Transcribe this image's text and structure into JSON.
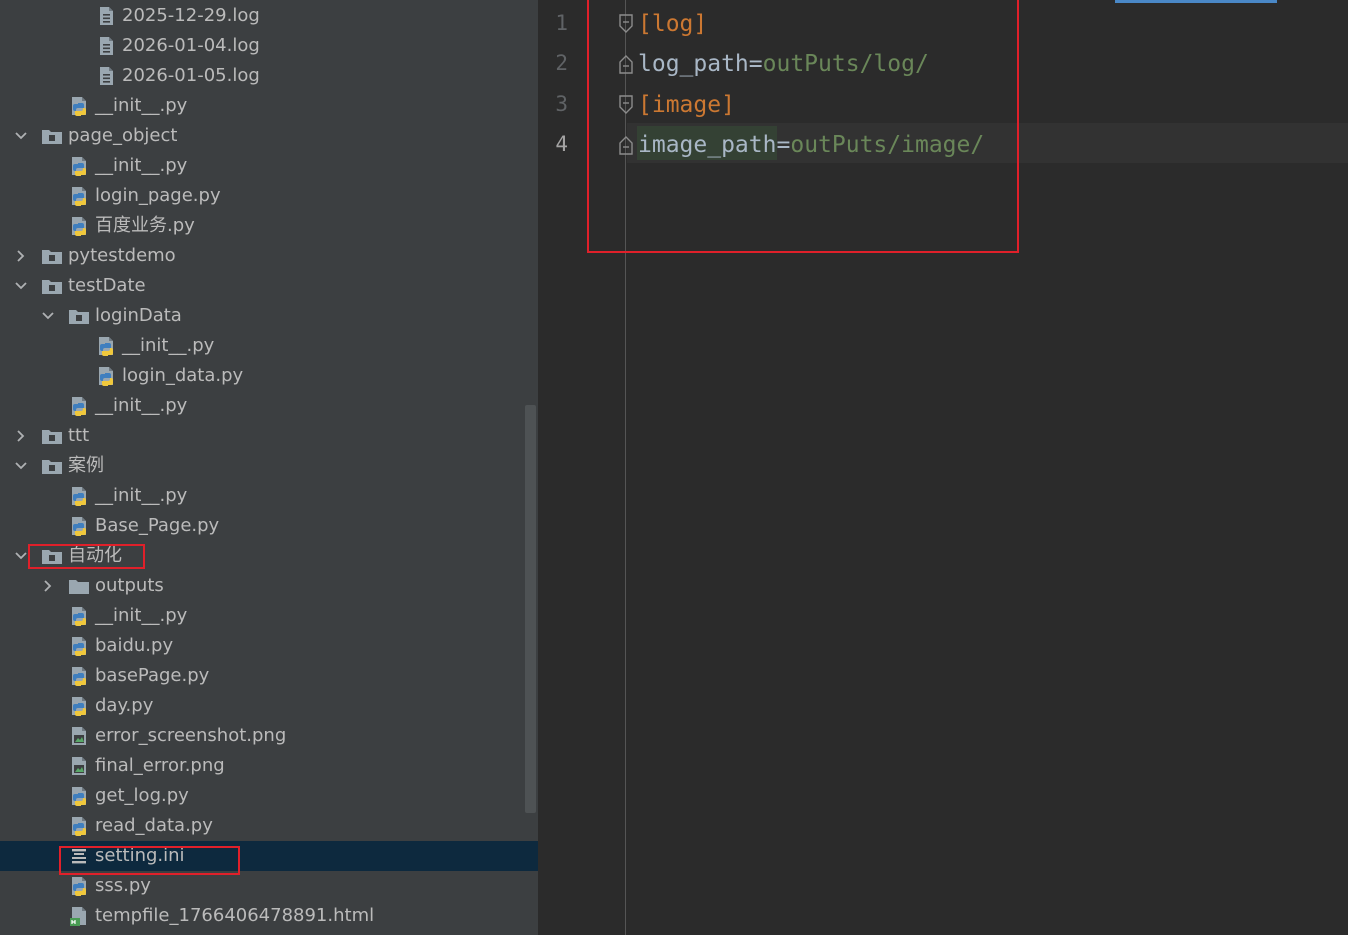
{
  "project_tree": {
    "items": [
      {
        "label": "2025-12-29.log",
        "icon": "log-file-icon",
        "expand": "none",
        "depth": 3
      },
      {
        "label": "2026-01-04.log",
        "icon": "log-file-icon",
        "expand": "none",
        "depth": 3
      },
      {
        "label": "2026-01-05.log",
        "icon": "log-file-icon",
        "expand": "none",
        "depth": 3
      },
      {
        "label": "__init__.py",
        "icon": "python-file-icon",
        "expand": "none",
        "depth": 2
      },
      {
        "label": "page_object",
        "icon": "package-folder-icon",
        "expand": "expanded",
        "depth": 1
      },
      {
        "label": "__init__.py",
        "icon": "python-file-icon",
        "expand": "none",
        "depth": 2
      },
      {
        "label": "login_page.py",
        "icon": "python-file-icon",
        "expand": "none",
        "depth": 2
      },
      {
        "label": "百度业务.py",
        "icon": "python-file-icon",
        "expand": "none",
        "depth": 2
      },
      {
        "label": "pytestdemo",
        "icon": "package-folder-icon",
        "expand": "collapsed",
        "depth": 1
      },
      {
        "label": "testDate",
        "icon": "package-folder-icon",
        "expand": "expanded",
        "depth": 1
      },
      {
        "label": "loginData",
        "icon": "package-folder-icon",
        "expand": "expanded",
        "depth": 2
      },
      {
        "label": "__init__.py",
        "icon": "python-file-icon",
        "expand": "none",
        "depth": 3
      },
      {
        "label": "login_data.py",
        "icon": "python-file-icon",
        "expand": "none",
        "depth": 3
      },
      {
        "label": "__init__.py",
        "icon": "python-file-icon",
        "expand": "none",
        "depth": 2
      },
      {
        "label": "ttt",
        "icon": "package-folder-icon",
        "expand": "collapsed",
        "depth": 1
      },
      {
        "label": "案例",
        "icon": "package-folder-icon",
        "expand": "expanded",
        "depth": 1
      },
      {
        "label": "__init__.py",
        "icon": "python-file-icon",
        "expand": "none",
        "depth": 2
      },
      {
        "label": "Base_Page.py",
        "icon": "python-file-icon",
        "expand": "none",
        "depth": 2
      },
      {
        "label": "自动化",
        "icon": "package-folder-icon",
        "expand": "expanded",
        "depth": 1
      },
      {
        "label": "outputs",
        "icon": "folder-icon",
        "expand": "collapsed",
        "depth": 2
      },
      {
        "label": "__init__.py",
        "icon": "python-file-icon",
        "expand": "none",
        "depth": 2
      },
      {
        "label": "baidu.py",
        "icon": "python-file-icon",
        "expand": "none",
        "depth": 2
      },
      {
        "label": "basePage.py",
        "icon": "python-file-icon",
        "expand": "none",
        "depth": 2
      },
      {
        "label": "day.py",
        "icon": "python-file-icon",
        "expand": "none",
        "depth": 2
      },
      {
        "label": "error_screenshot.png",
        "icon": "image-file-icon",
        "expand": "none",
        "depth": 2
      },
      {
        "label": "final_error.png",
        "icon": "image-file-icon",
        "expand": "none",
        "depth": 2
      },
      {
        "label": "get_log.py",
        "icon": "python-file-icon",
        "expand": "none",
        "depth": 2
      },
      {
        "label": "read_data.py",
        "icon": "python-file-icon",
        "expand": "none",
        "depth": 2
      },
      {
        "label": "setting.ini",
        "icon": "ini-file-icon",
        "expand": "none",
        "depth": 2,
        "selected": true
      },
      {
        "label": "sss.py",
        "icon": "python-file-icon",
        "expand": "none",
        "depth": 2
      },
      {
        "label": "tempfile_1766406478891.html",
        "icon": "html-file-icon",
        "expand": "none",
        "depth": 2
      }
    ]
  },
  "editor": {
    "current_line": 4,
    "lines": [
      {
        "num": "1",
        "tokens": [
          {
            "t": "[log]",
            "c": "sec"
          }
        ],
        "fold": "start"
      },
      {
        "num": "2",
        "tokens": [
          {
            "t": "log_path",
            "c": "key"
          },
          {
            "t": "=",
            "c": "eq"
          },
          {
            "t": "outPuts/log/",
            "c": "val"
          }
        ],
        "fold": "end"
      },
      {
        "num": "3",
        "tokens": [
          {
            "t": "[image]",
            "c": "sec"
          }
        ],
        "fold": "start"
      },
      {
        "num": "4",
        "tokens": [
          {
            "t": "image_path",
            "c": "key"
          },
          {
            "t": "=",
            "c": "eq"
          },
          {
            "t": "outPuts/image/",
            "c": "val"
          }
        ],
        "fold": "end"
      }
    ]
  },
  "colors": {
    "tree_bg": "#3c3f41",
    "editor_bg": "#2b2b2b",
    "selection": "#0d293e",
    "section": "#cc7832",
    "value": "#6a8759",
    "annotation_red": "#e0202a"
  }
}
